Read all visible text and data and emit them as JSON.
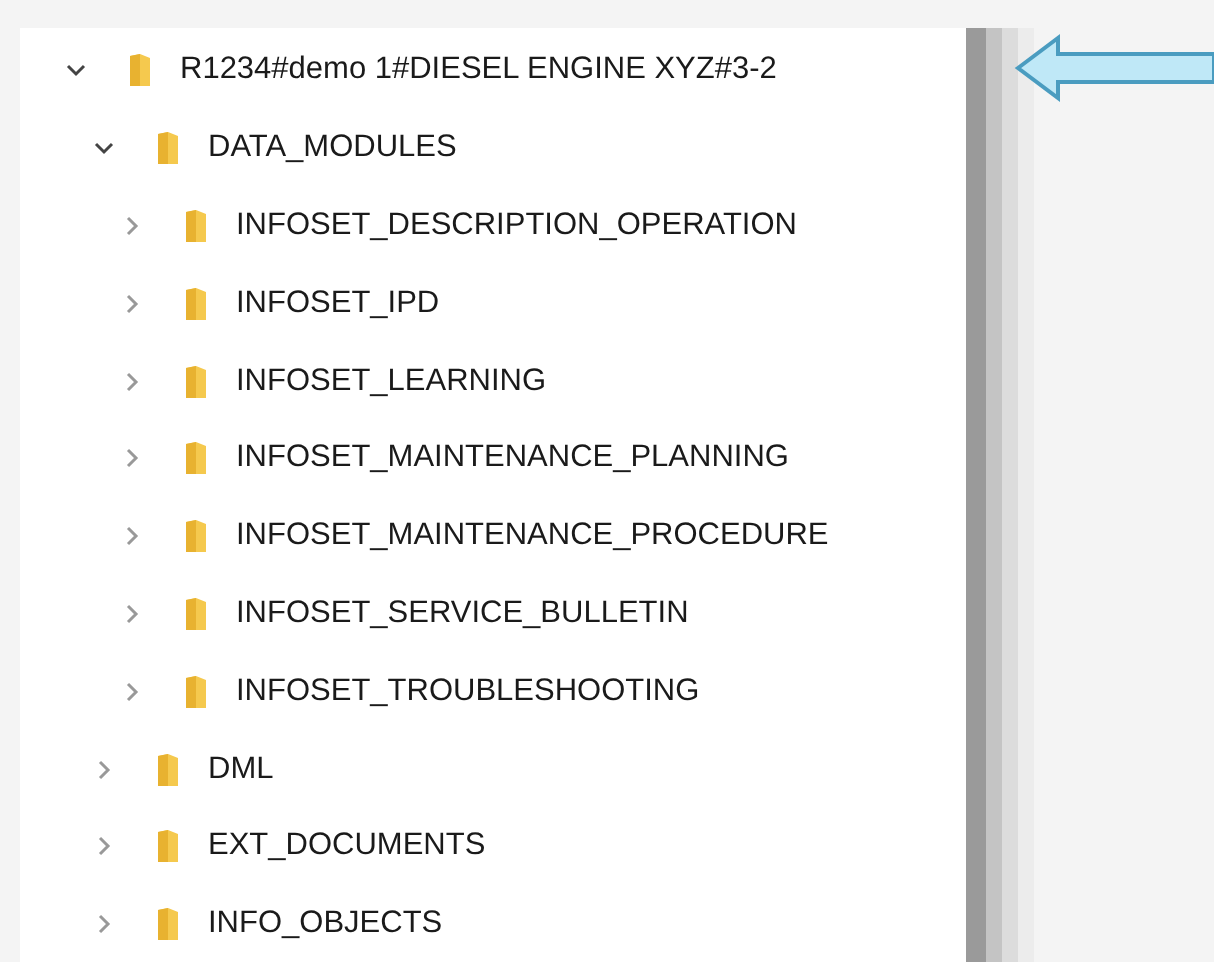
{
  "tree": [
    {
      "label": "R1234#demo 1#DIESEL ENGINE XYZ#3-2",
      "expanded": true,
      "children": [
        {
          "label": "DATA_MODULES",
          "expanded": true,
          "children": [
            {
              "label": "INFOSET_DESCRIPTION_OPERATION",
              "expanded": false
            },
            {
              "label": "INFOSET_IPD",
              "expanded": false
            },
            {
              "label": "INFOSET_LEARNING",
              "expanded": false
            },
            {
              "label": "INFOSET_MAINTENANCE_PLANNING",
              "expanded": false
            },
            {
              "label": "INFOSET_MAINTENANCE_PROCEDURE",
              "expanded": false
            },
            {
              "label": "INFOSET_SERVICE_BULLETIN",
              "expanded": false
            },
            {
              "label": "INFOSET_TROUBLESHOOTING",
              "expanded": false
            }
          ]
        },
        {
          "label": "DML",
          "expanded": false
        },
        {
          "label": "EXT_DOCUMENTS",
          "expanded": false
        },
        {
          "label": "INFO_OBJECTS",
          "expanded": false
        }
      ]
    }
  ]
}
